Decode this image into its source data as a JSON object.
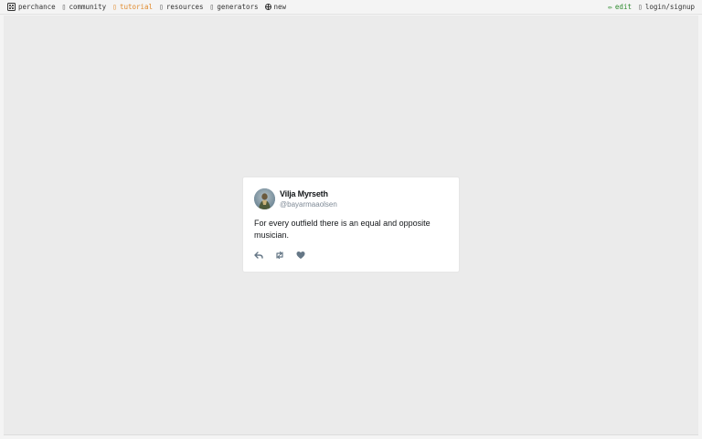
{
  "topbar": {
    "left": [
      {
        "icon": "dice-icon",
        "label": "perchance"
      },
      {
        "icon": "community-icon",
        "label": "community"
      },
      {
        "icon": "tutorial-icon",
        "label": "tutorial"
      },
      {
        "icon": "resources-icon",
        "label": "resources"
      },
      {
        "icon": "generators-icon",
        "label": "generators"
      },
      {
        "icon": "plus-globe-icon",
        "label": "new"
      }
    ],
    "right": [
      {
        "icon": "pencil-icon",
        "label": "edit"
      },
      {
        "icon": "user-icon",
        "label": "login/signup"
      }
    ]
  },
  "tweet": {
    "display_name": "Vilja Myrseth",
    "handle": "@bayarmaaolsen",
    "text": "For every outfield there is an equal and opposite musician.",
    "actions": [
      "reply-icon",
      "retweet-icon",
      "heart-icon"
    ]
  },
  "colors": {
    "tutorial": "#e08a2c",
    "edit": "#2e8b2e",
    "icon_gray": "#657786"
  }
}
